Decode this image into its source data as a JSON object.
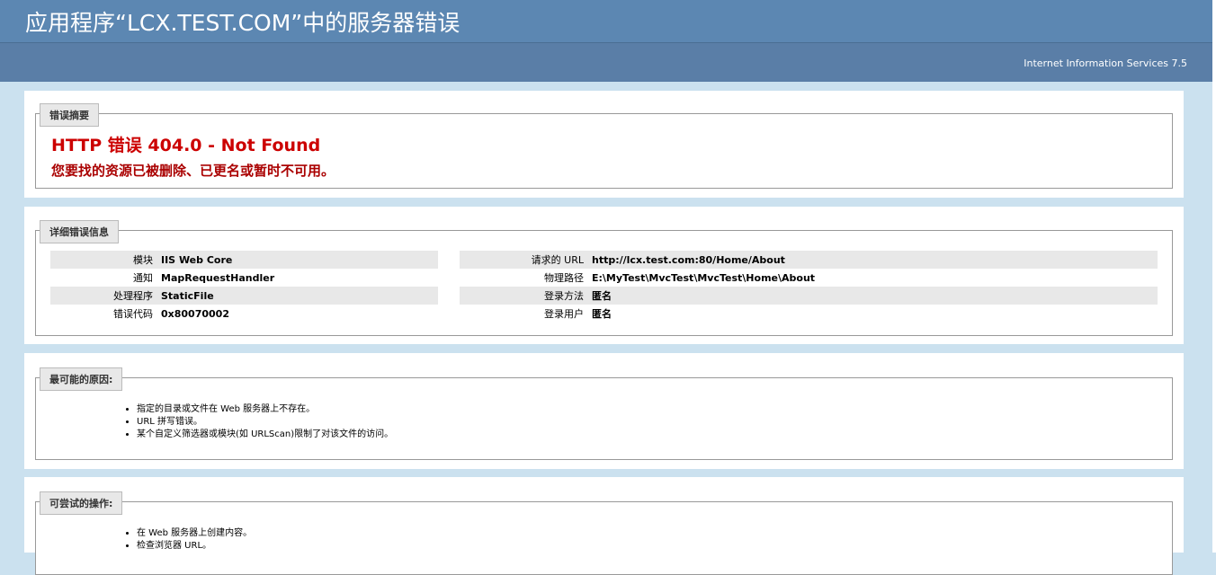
{
  "header": {
    "title": "应用程序“LCX.TEST.COM”中的服务器错误",
    "product": "Internet Information Services 7.5"
  },
  "summary": {
    "legend": "错误摘要",
    "title": "HTTP 错误 404.0 - Not Found",
    "description": "您要找的资源已被删除、已更名或暂时不可用。"
  },
  "details": {
    "legend": "详细错误信息",
    "left": [
      {
        "label": "模块",
        "value": "IIS Web Core"
      },
      {
        "label": "通知",
        "value": "MapRequestHandler"
      },
      {
        "label": "处理程序",
        "value": "StaticFile"
      },
      {
        "label": "错误代码",
        "value": "0x80070002"
      }
    ],
    "right": [
      {
        "label": "请求的 URL",
        "value": "http://lcx.test.com:80/Home/About"
      },
      {
        "label": "物理路径",
        "value": "E:\\MyTest\\MvcTest\\MvcTest\\Home\\About"
      },
      {
        "label": "登录方法",
        "value": "匿名"
      },
      {
        "label": "登录用户",
        "value": "匿名"
      }
    ]
  },
  "causes": {
    "legend": "最可能的原因:",
    "items": [
      "指定的目录或文件在 Web 服务器上不存在。",
      "URL 拼写错误。",
      "某个自定义筛选器或模块(如 URLScan)限制了对该文件的访问。"
    ]
  },
  "actions": {
    "legend": "可尝试的操作:",
    "items": [
      "在 Web 服务器上创建内容。",
      "检查浏览器 URL。"
    ]
  },
  "colors": {
    "header_bg": "#5c87b2",
    "page_bg": "#cbe1ef",
    "error_red": "#cc0000"
  }
}
